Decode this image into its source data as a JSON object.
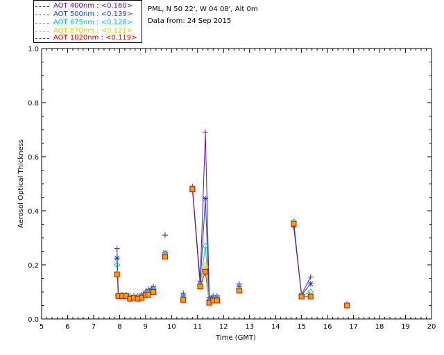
{
  "info": {
    "station": "PML, N 50 22', W 04 08', Alt 0m",
    "date": "Data from: 24 Sep 2015"
  },
  "legend": [
    {
      "label": "AOT  400nm : <0.160>",
      "color": "#6a0dad"
    },
    {
      "label": "AOT  500nm : <0.139>",
      "color": "#1f3fd6"
    },
    {
      "label": "AOT  675nm : <0.128>",
      "color": "#00d0a0"
    },
    {
      "label": "AOT  870nm : <0.121>",
      "color": "#e8d000"
    },
    {
      "label": "AOT 1020nm : <0.119>",
      "color": "#e00000"
    }
  ],
  "chart_data": {
    "type": "line",
    "xlabel": "Time (GMT)",
    "ylabel": "Aerosol Optical Thickness",
    "xlim": [
      5,
      20
    ],
    "ylim": [
      0.0,
      1.0
    ],
    "xticks": [
      "5",
      "6",
      "7",
      "8",
      "9",
      "10",
      "11",
      "12",
      "13",
      "14",
      "15",
      "16",
      "17",
      "18",
      "19",
      "20"
    ],
    "yticks": [
      "0.0",
      "0.2",
      "0.4",
      "0.6",
      "0.8",
      "1.0"
    ],
    "x": [
      7.9,
      7.95,
      8.1,
      8.25,
      8.4,
      8.55,
      8.7,
      8.85,
      9.0,
      9.1,
      9.3,
      9.75,
      10.45,
      10.8,
      11.1,
      11.3,
      11.45,
      11.6,
      11.75,
      12.6,
      14.7,
      15.0,
      15.35,
      16.75
    ],
    "series": [
      {
        "name": "AOT  400nm : <0.160>",
        "color": "#6a0dad",
        "values": [
          0.26,
          0.09,
          0.09,
          0.09,
          0.085,
          0.085,
          0.085,
          0.09,
          0.1,
          0.11,
          0.12,
          0.31,
          0.095,
          0.49,
          0.14,
          0.69,
          0.08,
          0.085,
          0.085,
          0.13,
          0.34,
          0.09,
          0.155,
          0.055
        ]
      },
      {
        "name": "AOT  500nm : <0.139>",
        "color": "#1f3fd6",
        "values": [
          0.225,
          0.088,
          0.088,
          0.088,
          0.082,
          0.082,
          0.082,
          0.088,
          0.098,
          0.105,
          0.115,
          0.245,
          0.085,
          0.485,
          0.13,
          0.445,
          0.072,
          0.08,
          0.08,
          0.12,
          0.355,
          0.088,
          0.13,
          0.052
        ]
      },
      {
        "name": "AOT  675nm : <0.128>",
        "color": "#00d0a0",
        "values": [
          0.2,
          0.087,
          0.087,
          0.087,
          0.08,
          0.08,
          0.08,
          0.085,
          0.095,
          0.1,
          0.11,
          0.24,
          0.078,
          0.48,
          0.125,
          0.27,
          0.065,
          0.075,
          0.075,
          0.11,
          0.36,
          0.086,
          0.1,
          0.05
        ]
      },
      {
        "name": "AOT  870nm : <0.121>",
        "color": "#e8d000",
        "values": [
          0.17,
          0.086,
          0.086,
          0.086,
          0.078,
          0.078,
          0.078,
          0.08,
          0.09,
          0.095,
          0.105,
          0.235,
          0.072,
          0.478,
          0.12,
          0.2,
          0.06,
          0.07,
          0.07,
          0.105,
          0.355,
          0.084,
          0.085,
          0.05
        ]
      },
      {
        "name": "AOT 1020nm : <0.119>",
        "color": "#e00000",
        "values": [
          0.165,
          0.085,
          0.085,
          0.085,
          0.075,
          0.078,
          0.075,
          0.078,
          0.088,
          0.09,
          0.1,
          0.23,
          0.07,
          0.48,
          0.12,
          0.175,
          0.06,
          0.068,
          0.068,
          0.105,
          0.352,
          0.083,
          0.083,
          0.05
        ]
      }
    ],
    "grid": false,
    "legend_position": "top-left"
  }
}
